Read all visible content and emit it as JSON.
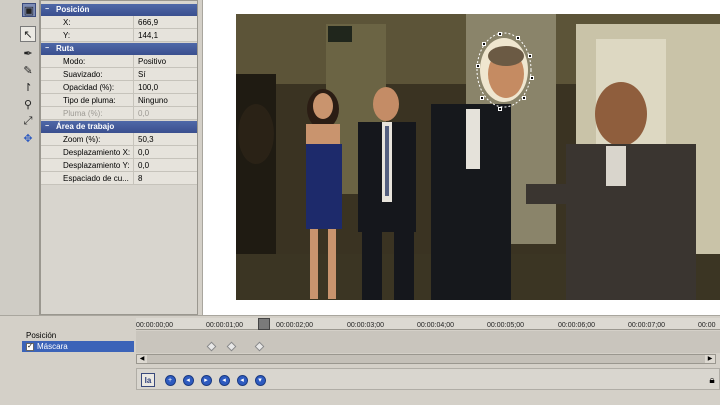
{
  "properties": {
    "position": {
      "title": "Posición",
      "rows": [
        {
          "label": "X:",
          "value": "666,9"
        },
        {
          "label": "Y:",
          "value": "144,1"
        }
      ]
    },
    "path": {
      "title": "Ruta",
      "rows": [
        {
          "label": "Modo:",
          "value": "Positivo"
        },
        {
          "label": "Suavizado:",
          "value": "Sí"
        },
        {
          "label": "Opacidad (%):",
          "value": "100,0"
        },
        {
          "label": "Tipo de pluma:",
          "value": "Ninguno"
        },
        {
          "label": "Pluma (%):",
          "value": "0,0"
        }
      ]
    },
    "workspace": {
      "title": "Área de trabajo",
      "rows": [
        {
          "label": "Zoom (%):",
          "value": "50,3"
        },
        {
          "label": "Desplazamiento X:",
          "value": "0,0"
        },
        {
          "label": "Desplazamiento Y:",
          "value": "0,0"
        },
        {
          "label": "Espaciado de cu...",
          "value": "8"
        }
      ]
    }
  },
  "timeline": {
    "tracks": [
      {
        "label": "Posición"
      },
      {
        "label": "Máscara",
        "checked": true
      }
    ],
    "ruler": [
      "00:00:00;00",
      "00:00:01;00",
      "00:00:02;00",
      "00:00:03;00",
      "00:00:04;00",
      "00:00:05;00",
      "00:00:06;00",
      "00:00:07;00",
      "00:00"
    ],
    "keyframe_times_seconds": [
      1.0,
      1.3,
      1.7
    ]
  },
  "tools": [
    "mask-tool-icon",
    "arrow-tool-icon",
    "pen-tool-icon",
    "anchor-pen-icon",
    "anchor-convert-icon",
    "zoom-icon",
    "zoom-pan-icon",
    "move-icon"
  ],
  "keyframe_tools": [
    "first-keyframe-icon",
    "prev-keyframe-icon",
    "next-keyframe-icon",
    "last-keyframe-icon",
    "add-keyframe-icon",
    "remove-keyframe-icon"
  ],
  "colors": {
    "section_header": "#3f58a0",
    "selection": "#3b63b8"
  }
}
